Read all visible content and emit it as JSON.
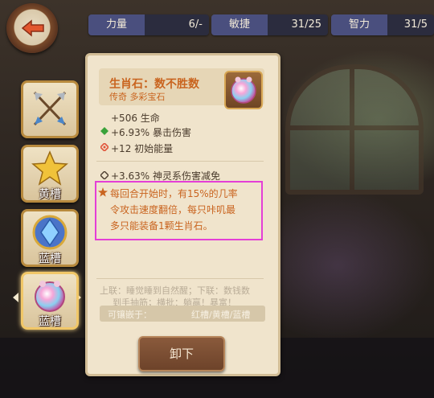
{
  "stats": [
    {
      "label": "力量",
      "value": "6/-"
    },
    {
      "label": "敏捷",
      "value": "31/25"
    },
    {
      "label": "智力",
      "value": "31/5"
    }
  ],
  "slots": [
    {
      "icon": "crossed-arrows-icon",
      "label": ""
    },
    {
      "icon": "yellow-star-gem-icon",
      "label": "黄槽"
    },
    {
      "icon": "blue-crystal-gem-icon",
      "label": "蓝槽"
    },
    {
      "icon": "rainbow-orb-gem-icon",
      "label": "蓝槽"
    }
  ],
  "item": {
    "title": "生肖石：数不胜数",
    "subtitle": "传奇 多彩宝石",
    "stats": [
      "+506 生命",
      "+6.93% 暴击伤害",
      "+12 初始能量"
    ],
    "extra": "+3.63% 神灵系伤害减免",
    "effect_lines": [
      "每回合开始时，有15%的几率",
      "令攻击速度翻倍，每只咔叽最",
      "多只能装备1颗生肖石。"
    ],
    "flavor_lines": [
      "上联：睡觉睡到自然醒；下联：数钱数",
      "到手抽筋；横批：躺赢！暴富！"
    ],
    "socket_label": "可镶嵌于：",
    "socket_values": "红槽/黄槽/蓝槽"
  },
  "unequip_label": "卸下",
  "colors": {
    "accent": "#c9641f",
    "highlight": "#e43fd6",
    "crit": "#3aa23a",
    "energy": "#e0543a"
  }
}
